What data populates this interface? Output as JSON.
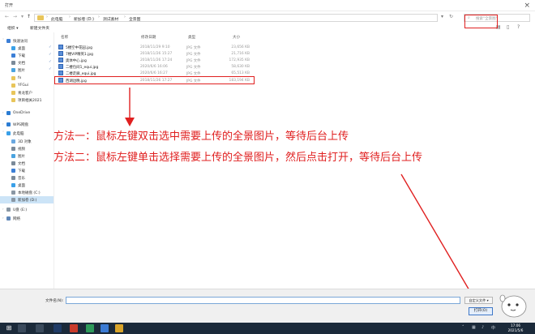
{
  "window": {
    "title": "打开"
  },
  "nav": {
    "breadcrumbs": [
      "此电脑",
      "新加卷 (D:)",
      "测试素材",
      "全景图"
    ],
    "search_placeholder": "搜索\"全景图\""
  },
  "toolbar": {
    "organize": "组织 ▾",
    "new_folder": "新建文件夹"
  },
  "sidebar": {
    "items": [
      {
        "label": "快速访问",
        "color": "#3c7fd6",
        "pinned": false
      },
      {
        "label": "桌面",
        "color": "#3aa0e8",
        "pinned": true
      },
      {
        "label": "下载",
        "color": "#3c7fd6",
        "pinned": true
      },
      {
        "label": "文档",
        "color": "#7b8a99",
        "pinned": true
      },
      {
        "label": "图片",
        "color": "#4aa3df",
        "pinned": true
      },
      {
        "label": "fx",
        "color": "#e8c55a",
        "pinned": false
      },
      {
        "label": "YFGui",
        "color": "#e8c55a",
        "pinned": false
      },
      {
        "label": "青龙客户",
        "color": "#e8c55a",
        "pinned": false
      },
      {
        "label": "项目相关2021",
        "color": "#e8c55a",
        "pinned": false
      },
      {
        "label": "OneDrive",
        "color": "#2b7cd3",
        "pinned": false
      },
      {
        "label": "WPS网盘",
        "color": "#2b7cd3",
        "pinned": false
      },
      {
        "label": "此电脑",
        "color": "#3aa0e8",
        "pinned": false
      },
      {
        "label": "3D 对象",
        "color": "#6aa8e0",
        "pinned": false
      },
      {
        "label": "视频",
        "color": "#7b8a99",
        "pinned": false
      },
      {
        "label": "图片",
        "color": "#4aa3df",
        "pinned": false
      },
      {
        "label": "文档",
        "color": "#7b8a99",
        "pinned": false
      },
      {
        "label": "下载",
        "color": "#3c7fd6",
        "pinned": false
      },
      {
        "label": "音乐",
        "color": "#7b8a99",
        "pinned": false
      },
      {
        "label": "桌面",
        "color": "#3aa0e8",
        "pinned": false
      },
      {
        "label": "本地磁盘 (C:)",
        "color": "#8a97a4",
        "pinned": false
      },
      {
        "label": "新加卷 (D:)",
        "color": "#8a97a4",
        "pinned": false
      },
      {
        "label": "U盘 (E:)",
        "color": "#8a97a4",
        "pinned": false
      },
      {
        "label": "网络",
        "color": "#5f87b8",
        "pinned": false
      }
    ]
  },
  "columns": {
    "name": "名称",
    "date": "修改日期",
    "type": "类型",
    "size": "大小"
  },
  "files": [
    {
      "name": "5楼空中花园.jpg",
      "date": "2018/11/29 9:10",
      "type": "JPG 文件",
      "size": "23,656 KB"
    },
    {
      "name": "7楼VIP精英1.jpg",
      "date": "2018/11/26 15:27",
      "type": "JPG 文件",
      "size": "21,716 KB"
    },
    {
      "name": "奥体中心.jpg",
      "date": "2018/11/26 17:24",
      "type": "JPG 文件",
      "size": "172,935 KB"
    },
    {
      "name": "二楼包间1_equi.jpg",
      "date": "2020/6/6 16:06",
      "type": "JPG 文件",
      "size": "58,630 KB"
    },
    {
      "name": "二楼走廊_equi.jpg",
      "date": "2020/6/6 16:27",
      "type": "JPG 文件",
      "size": "65,513 KB"
    },
    {
      "name": "西湖边晚.jpg",
      "date": "2018/11/26 17:27",
      "type": "JPG 文件",
      "size": "183,194 KB"
    }
  ],
  "annotations": {
    "line1": "方法一：鼠标左键双击选中需要上传的全景图片，等待后台上传",
    "line2": "方法二：鼠标左键单击选择需要上传的全景图片，然后点击打开，等待后台上传"
  },
  "footer": {
    "filename_label": "文件名(N):",
    "filename_value": "",
    "filter_label": "自定义文件 ▾",
    "open_label": "打开(O)"
  },
  "clock": {
    "time": "17:06",
    "date": "2021/5/6"
  },
  "colors": {
    "annotation": "#e02020",
    "selection": "#cce4f7",
    "taskbar": "#1b2a3a"
  }
}
